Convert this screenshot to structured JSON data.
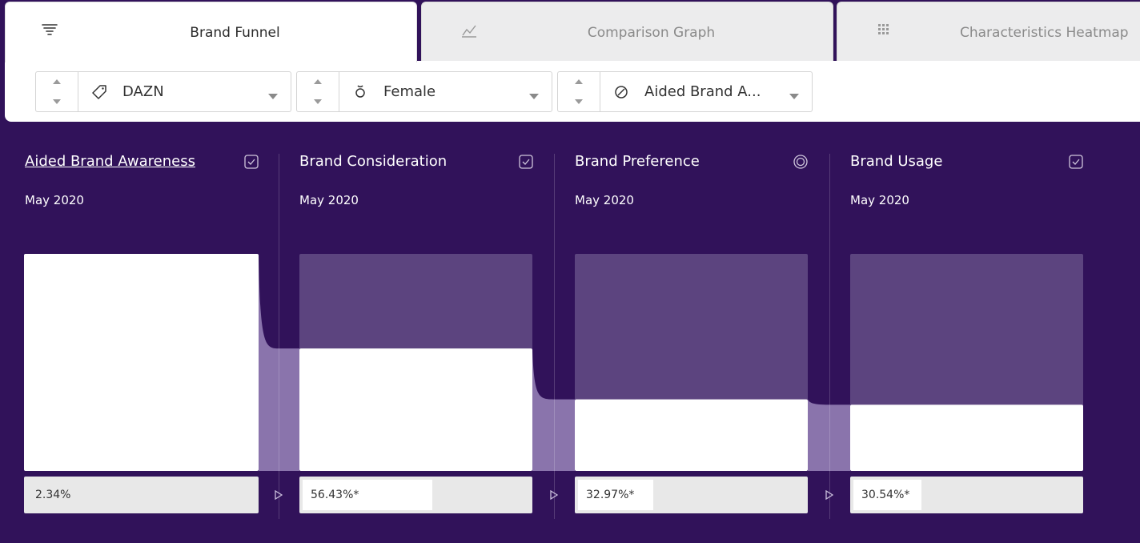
{
  "tabs": [
    {
      "label": "Brand Funnel",
      "icon": "funnel-icon",
      "active": true
    },
    {
      "label": "Comparison Graph",
      "icon": "line-graph-icon",
      "active": false
    },
    {
      "label": "Characteristics Heatmap",
      "icon": "grid-dots-icon",
      "active": false
    }
  ],
  "filters": [
    {
      "value": "DAZN",
      "icon": "tag-icon"
    },
    {
      "value": "Female",
      "icon": "female-icon"
    },
    {
      "value": "Aided Brand A...",
      "icon": "metric-icon"
    }
  ],
  "stages": [
    {
      "title": "Aided Brand Awareness",
      "date": "May 2020",
      "value": "2.34%",
      "fill_fraction": 1.0,
      "selected": true,
      "icon": "checkbox-icon"
    },
    {
      "title": "Brand Consideration",
      "date": "May 2020",
      "value": "56.43%*",
      "fill_fraction": 0.564,
      "selected": false,
      "icon": "checkbox-icon"
    },
    {
      "title": "Brand Preference",
      "date": "May 2020",
      "value": "32.97%*",
      "fill_fraction": 0.33,
      "selected": false,
      "icon": "radio-target-icon"
    },
    {
      "title": "Brand Usage",
      "date": "May 2020",
      "value": "30.54%*",
      "fill_fraction": 0.305,
      "selected": false,
      "icon": "checkbox-icon"
    }
  ],
  "colors": {
    "background": "#31125a",
    "bar_track": "#5c447f",
    "flow": "#8a74ac",
    "bar_fill": "#ffffff"
  }
}
